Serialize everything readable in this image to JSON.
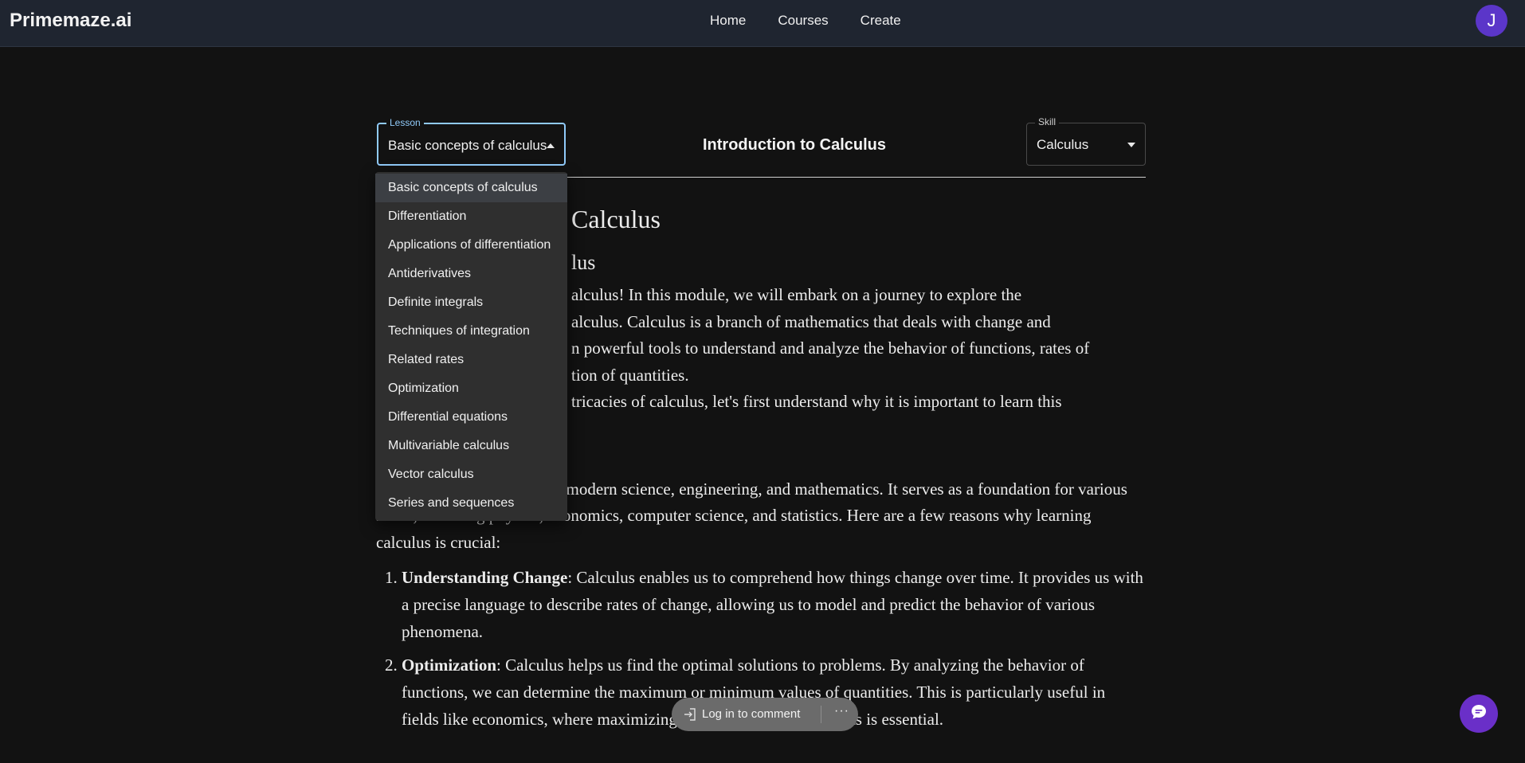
{
  "brand": "Primemaze.ai",
  "nav": {
    "home": "Home",
    "courses": "Courses",
    "create": "Create"
  },
  "user": {
    "initial": "J"
  },
  "lesson_select": {
    "label": "Lesson",
    "value": "Basic concepts of calculus",
    "options": [
      "Basic concepts of calculus",
      "Differentiation",
      "Applications of differentiation",
      "Antiderivatives",
      "Definite integrals",
      "Techniques of integration",
      "Related rates",
      "Optimization",
      "Differential equations",
      "Multivariable calculus",
      "Vector calculus",
      "Series and sequences"
    ]
  },
  "header_title": "Introduction to Calculus",
  "skill_select": {
    "label": "Skill",
    "value": "Calculus"
  },
  "article": {
    "h1_visible": "Calculus",
    "h2_visible": "lus",
    "intro_lines": [
      "alculus! In this module, we will embark on a journey to explore the",
      "alculus. Calculus is a branch of mathematics that deals with change and",
      "n powerful tools to understand and analyze the behavior of functions, rates of",
      "tion of quantities.",
      "tricacies of calculus, let's first understand why it is important to learn this"
    ],
    "why_para": "Calculus is a cornerstone of modern science, engineering, and mathematics. It serves as a foundation for various fields, including physics, economics, computer science, and statistics. Here are a few reasons why learning calculus is crucial:",
    "list": [
      {
        "term": "Understanding Change",
        "text": ": Calculus enables us to comprehend how things change over time. It provides us with a precise language to describe rates of change, allowing us to model and predict the behavior of various phenomena."
      },
      {
        "term": "Optimization",
        "text": ": Calculus helps us find the optimal solutions to problems. By analyzing the behavior of functions, we can determine the maximum or minimum values of quantities. This is particularly useful in fields like economics, where maximizing profits or minimizing costs is essential."
      }
    ]
  },
  "comment_bar": {
    "login_text": "Log in to comment",
    "more": "···"
  },
  "icons": {
    "login": "login-arrow-icon",
    "chat": "chat-bubble-icon"
  },
  "colors": {
    "accent_focus": "#90caf9",
    "avatar": "#5b36c9",
    "chat_fab": "#6a2fc8"
  }
}
